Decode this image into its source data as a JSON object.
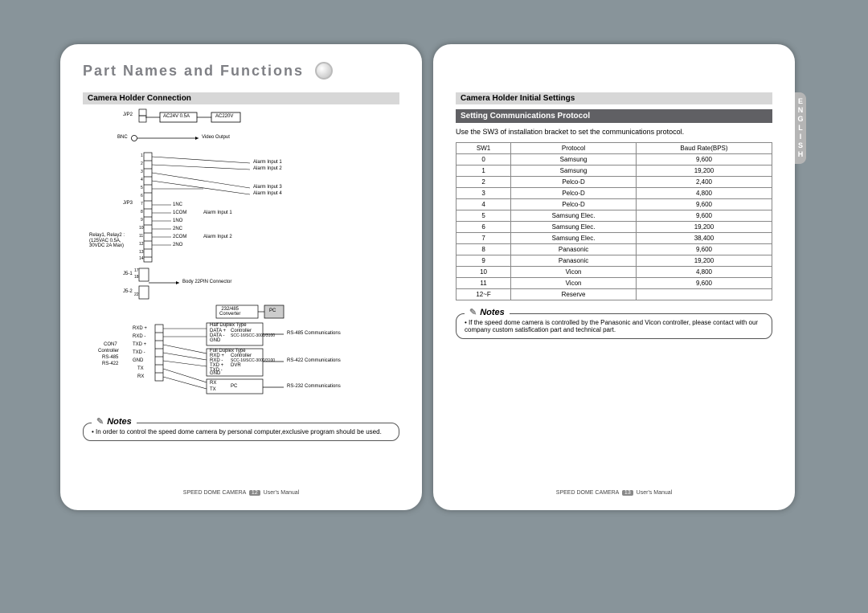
{
  "heading": "Part Names and Functions",
  "language_tab": "ENGLISH",
  "left": {
    "section_title": "Camera Holder Connection",
    "diagram": {
      "labels": {
        "ac24v": "AC24V 0.5A",
        "ac220v": "AC220V",
        "jp2": "J/P2",
        "bnc": "BNC",
        "video_out": "Video Output",
        "alarm_in1": "Alarm Input 1",
        "alarm_in2": "Alarm Input 2",
        "alarm_in3": "Alarm Input 3",
        "alarm_in4": "Alarm Input 4",
        "jp3": "J/P3",
        "pin_1nc": "1NC",
        "pin_1com": "1COM",
        "pin_1no": "1NO",
        "pin_2nc": "2NC",
        "pin_2com": "2COM",
        "pin_2no": "2NO",
        "relay_spec": "Relay1, Relay2 :\n(125VAC 0.5A,\n30VDC 2A Max)",
        "alarm_input1b": "Alarm Input 1",
        "alarm_input2b": "Alarm Input 2",
        "j51": "J5-1",
        "j52": "J5-2",
        "body22": "Body 22PIN Connector",
        "converter_box": "232/485\nConverter",
        "pc_box": "PC",
        "half_duplex": "Half Duplex Type",
        "full_duplex": "Full Duplex Type",
        "ctrl_line1": "Controller",
        "scc_model1": "SCC-16/SCC-3000/3100",
        "scc_model2": "SCC-16/SCC-3000/3100",
        "dvr": "DVR",
        "rs485_comm": "RS-485 Communications",
        "rs422_comm": "RS-422 Communications",
        "rs232_comm": "RS-232 Communications",
        "con7": "CON7",
        "controller": "Controller",
        "rs485": "RS-485",
        "rs422": "RS-422",
        "rxdp": "RXD +",
        "rxdm": "RXD -",
        "txdp": "TXD +",
        "txdm": "TXD -",
        "gnd": "GND",
        "tx": "TX",
        "rx": "RX",
        "datap": "DATA +",
        "datam": "DATA -"
      }
    },
    "note": "In order to control the speed dome camera by personal computer,exclusive program should be used.",
    "footer_left": "SPEED DOME CAMERA",
    "footer_page_label": "12",
    "footer_right": "User's Manual"
  },
  "right": {
    "section_title": "Camera Holder Initial Settings",
    "subhead": "Setting Communications Protocol",
    "body": "Use the SW3 of installation bracket to set the communications protocol.",
    "table": {
      "headers": [
        "SW1",
        "Protocol",
        "Baud Rate(BPS)"
      ],
      "rows": [
        [
          "0",
          "Samsung",
          "9,600"
        ],
        [
          "1",
          "Samsung",
          "19,200"
        ],
        [
          "2",
          "Pelco-D",
          "2,400"
        ],
        [
          "3",
          "Pelco-D",
          "4,800"
        ],
        [
          "4",
          "Pelco-D",
          "9,600"
        ],
        [
          "5",
          "Samsung Elec.",
          "9,600"
        ],
        [
          "6",
          "Samsung Elec.",
          "19,200"
        ],
        [
          "7",
          "Samsung Elec.",
          "38,400"
        ],
        [
          "8",
          "Panasonic",
          "9,600"
        ],
        [
          "9",
          "Panasonic",
          "19,200"
        ],
        [
          "10",
          "Vicon",
          "4,800"
        ],
        [
          "11",
          "Vicon",
          "9,600"
        ],
        [
          "12~F",
          "Reserve",
          ""
        ]
      ]
    },
    "note": "If the speed dome camera is controlled by the Panasonic and Vicon controller, please contact with our company custom satisfication part and technical part.",
    "footer_left": "SPEED DOME CAMERA",
    "footer_page_label": "13",
    "footer_right": "User's Manual"
  },
  "notes_label": "Notes"
}
